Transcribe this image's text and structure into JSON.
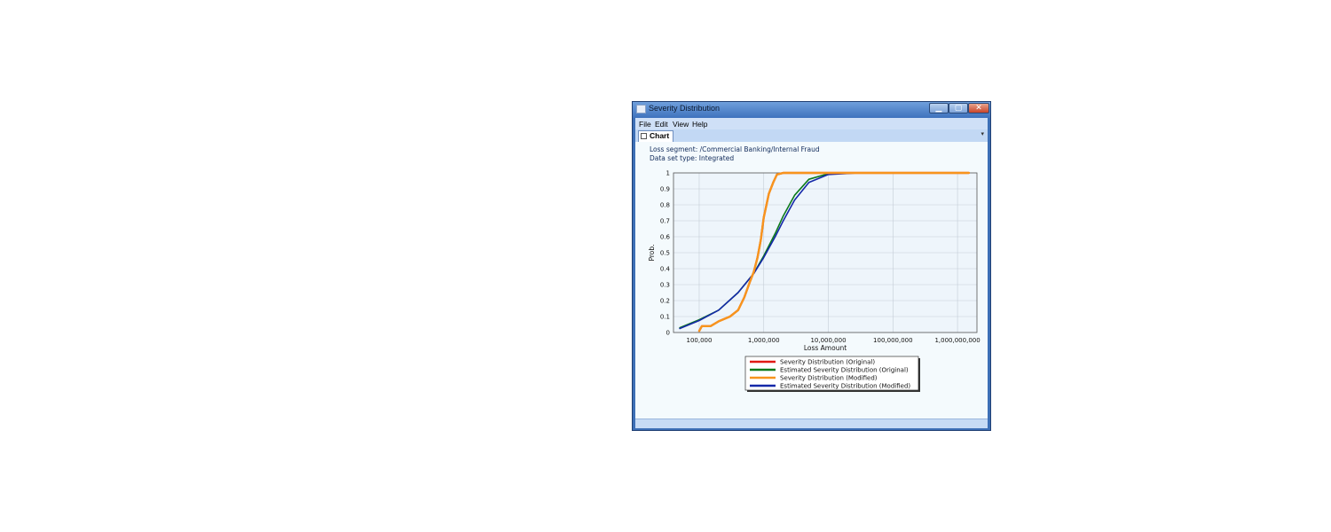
{
  "window": {
    "title": "Severity Distribution",
    "min_glyph": "▁",
    "max_glyph": "▢",
    "close_glyph": "✕"
  },
  "menu": {
    "items": [
      "File",
      "Edit",
      "View",
      "Help"
    ]
  },
  "tabs": [
    {
      "label": "Chart",
      "active": true
    }
  ],
  "tab_dropdown_glyph": "▾",
  "info": {
    "loss_segment": "Loss segment: /Commercial Banking/Internal Fraud",
    "data_set_type": "Data set type: Integrated"
  },
  "colors": {
    "original": "#e11a14",
    "estimated_original": "#0c7a1c",
    "modified": "#f7941d",
    "estimated_modified": "#1428a8"
  },
  "chart_data": {
    "type": "line",
    "xlabel": "Loss Amount",
    "ylabel": "Prob.",
    "x_scale": "log",
    "xlim": [
      40000,
      2000000000
    ],
    "ylim": [
      0,
      1
    ],
    "x_ticks": [
      100000,
      1000000,
      10000000,
      100000000,
      1000000000
    ],
    "x_tick_labels": [
      "100,000",
      "1,000,000",
      "10,000,000",
      "100,000,000",
      "1,000,000,000"
    ],
    "y_ticks": [
      0,
      0.1,
      0.2,
      0.3,
      0.4,
      0.5,
      0.6,
      0.7,
      0.8,
      0.9,
      1
    ],
    "y_tick_labels": [
      "0",
      "0.1",
      "0.2",
      "0.3",
      "0.4",
      "0.5",
      "0.6",
      "0.7",
      "0.8",
      "0.9",
      "1"
    ],
    "grid": true,
    "legend_position": "bottom",
    "series": [
      {
        "name": "Severity Distribution (Original)",
        "color_key": "original",
        "width": 2.2,
        "points": [
          [
            100000,
            0.01
          ],
          [
            110000,
            0.04
          ],
          [
            150000,
            0.04
          ],
          [
            200000,
            0.07
          ],
          [
            300000,
            0.1
          ],
          [
            400000,
            0.14
          ],
          [
            500000,
            0.22
          ],
          [
            600000,
            0.31
          ],
          [
            700000,
            0.38
          ],
          [
            800000,
            0.47
          ],
          [
            900000,
            0.58
          ],
          [
            1000000,
            0.72
          ],
          [
            1100000,
            0.8
          ],
          [
            1200000,
            0.87
          ],
          [
            1400000,
            0.94
          ],
          [
            1600000,
            0.99
          ],
          [
            2000000,
            1.0
          ],
          [
            5000000,
            1.0
          ],
          [
            20000000,
            1.0
          ],
          [
            100000000,
            1.0
          ],
          [
            1000000000,
            1.0
          ],
          [
            1500000000,
            1.0
          ]
        ]
      },
      {
        "name": "Estimated Severity Distribution (Original)",
        "color_key": "estimated_original",
        "width": 1.6,
        "points": [
          [
            50000,
            0.03
          ],
          [
            100000,
            0.08
          ],
          [
            200000,
            0.14
          ],
          [
            400000,
            0.25
          ],
          [
            700000,
            0.37
          ],
          [
            1000000,
            0.48
          ],
          [
            1500000,
            0.62
          ],
          [
            2000000,
            0.73
          ],
          [
            3000000,
            0.86
          ],
          [
            5000000,
            0.96
          ],
          [
            10000000,
            0.995
          ],
          [
            30000000,
            1.0
          ],
          [
            100000000,
            1.0
          ],
          [
            1000000000,
            1.0
          ],
          [
            1500000000,
            1.0
          ]
        ]
      },
      {
        "name": "Severity Distribution (Modified)",
        "color_key": "modified",
        "width": 2.4,
        "points": [
          [
            100000,
            0.01
          ],
          [
            110000,
            0.04
          ],
          [
            150000,
            0.04
          ],
          [
            200000,
            0.07
          ],
          [
            300000,
            0.1
          ],
          [
            400000,
            0.14
          ],
          [
            500000,
            0.22
          ],
          [
            600000,
            0.31
          ],
          [
            700000,
            0.38
          ],
          [
            800000,
            0.47
          ],
          [
            900000,
            0.58
          ],
          [
            1000000,
            0.72
          ],
          [
            1100000,
            0.8
          ],
          [
            1200000,
            0.87
          ],
          [
            1400000,
            0.94
          ],
          [
            1600000,
            0.99
          ],
          [
            2000000,
            1.0
          ],
          [
            5000000,
            1.0
          ],
          [
            20000000,
            1.0
          ],
          [
            100000000,
            1.0
          ],
          [
            1000000000,
            1.0
          ],
          [
            1500000000,
            1.0
          ]
        ]
      },
      {
        "name": "Estimated Severity Distribution (Modified)",
        "color_key": "estimated_modified",
        "width": 1.6,
        "points": [
          [
            50000,
            0.025
          ],
          [
            100000,
            0.075
          ],
          [
            200000,
            0.14
          ],
          [
            400000,
            0.25
          ],
          [
            700000,
            0.37
          ],
          [
            1000000,
            0.47
          ],
          [
            1500000,
            0.6
          ],
          [
            2000000,
            0.7
          ],
          [
            3000000,
            0.83
          ],
          [
            5000000,
            0.94
          ],
          [
            10000000,
            0.99
          ],
          [
            30000000,
            1.0
          ],
          [
            100000000,
            1.0
          ],
          [
            1000000000,
            1.0
          ],
          [
            1500000000,
            1.0
          ]
        ]
      }
    ]
  }
}
